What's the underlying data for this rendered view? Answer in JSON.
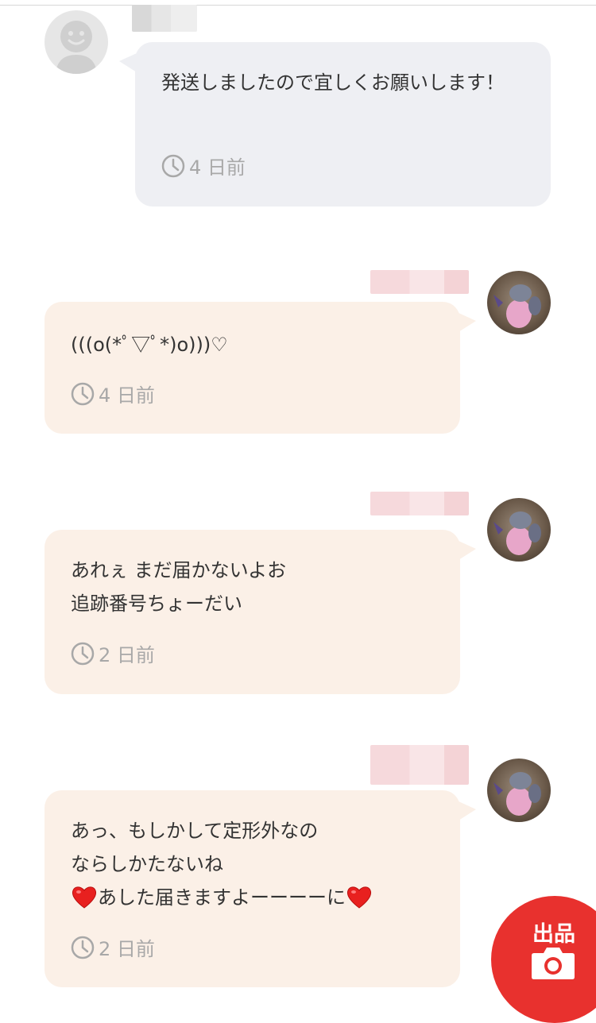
{
  "messages": [
    {
      "sender": "self",
      "text": "発送しましたので宜しくお願いします！",
      "time": "4 日前"
    },
    {
      "sender": "other",
      "text": "(((o(*ﾟ▽ﾟ*)o)))♡",
      "time": "4 日前"
    },
    {
      "sender": "other",
      "text": "あれぇ まだ届かないよお\n追跡番号ちょーだい",
      "time": "2 日前"
    },
    {
      "sender": "other",
      "line1": "あっ、もしかして定形外なの",
      "line2": "ならしかたないね",
      "line3": "あした届きますよーーーーに",
      "time": "2 日前"
    }
  ],
  "sell_button": {
    "label": "出品",
    "icon": "camera-icon",
    "color": "#e8312e"
  },
  "icons": {
    "clock": "clock-icon",
    "heart": "heart-icon",
    "avatar_default": "default-avatar-icon"
  },
  "colors": {
    "self_bubble": "#eeeff3",
    "other_bubble": "#fbf0e7",
    "timestamp": "#a8a8a8"
  }
}
